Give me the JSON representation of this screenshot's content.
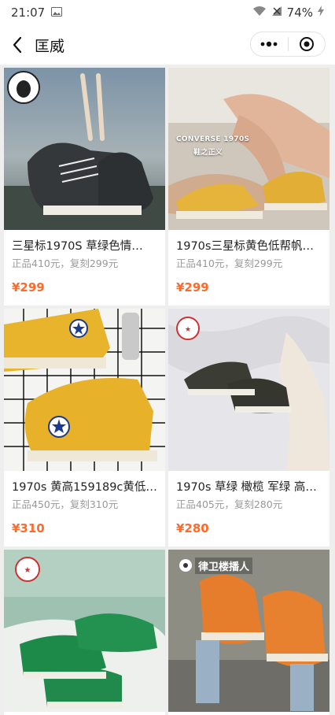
{
  "status": {
    "time": "21:07",
    "battery": "74%"
  },
  "nav": {
    "title": "匡威"
  },
  "products": [
    {
      "title": "三星标1970S 草绿色情…",
      "sub": "正品410元，复刻299元",
      "price": "¥299"
    },
    {
      "title": "1970s三星标黄色低帮帆…",
      "sub": "正品410元，复刻299元",
      "price": "¥299",
      "overlay": "CONVERSE 1970S",
      "overlay2": "鞋之正义"
    },
    {
      "title": "1970s 黄高159189c黄低…",
      "sub": "正品450元，复刻310元",
      "price": "¥310"
    },
    {
      "title": "1970s 草绿 橄榄 军绿 高…",
      "sub": "正品405元，复刻280元",
      "price": "¥280"
    },
    {
      "title": "",
      "sub": "",
      "price": ""
    },
    {
      "title": "",
      "sub": "",
      "price": "",
      "overlay": "律卫楼播人"
    }
  ],
  "colors": {
    "price": "#ff6a2a",
    "background": "#eeeeee"
  },
  "icons": [
    "back-arrow-icon",
    "more-dots-icon",
    "target-icon"
  ]
}
